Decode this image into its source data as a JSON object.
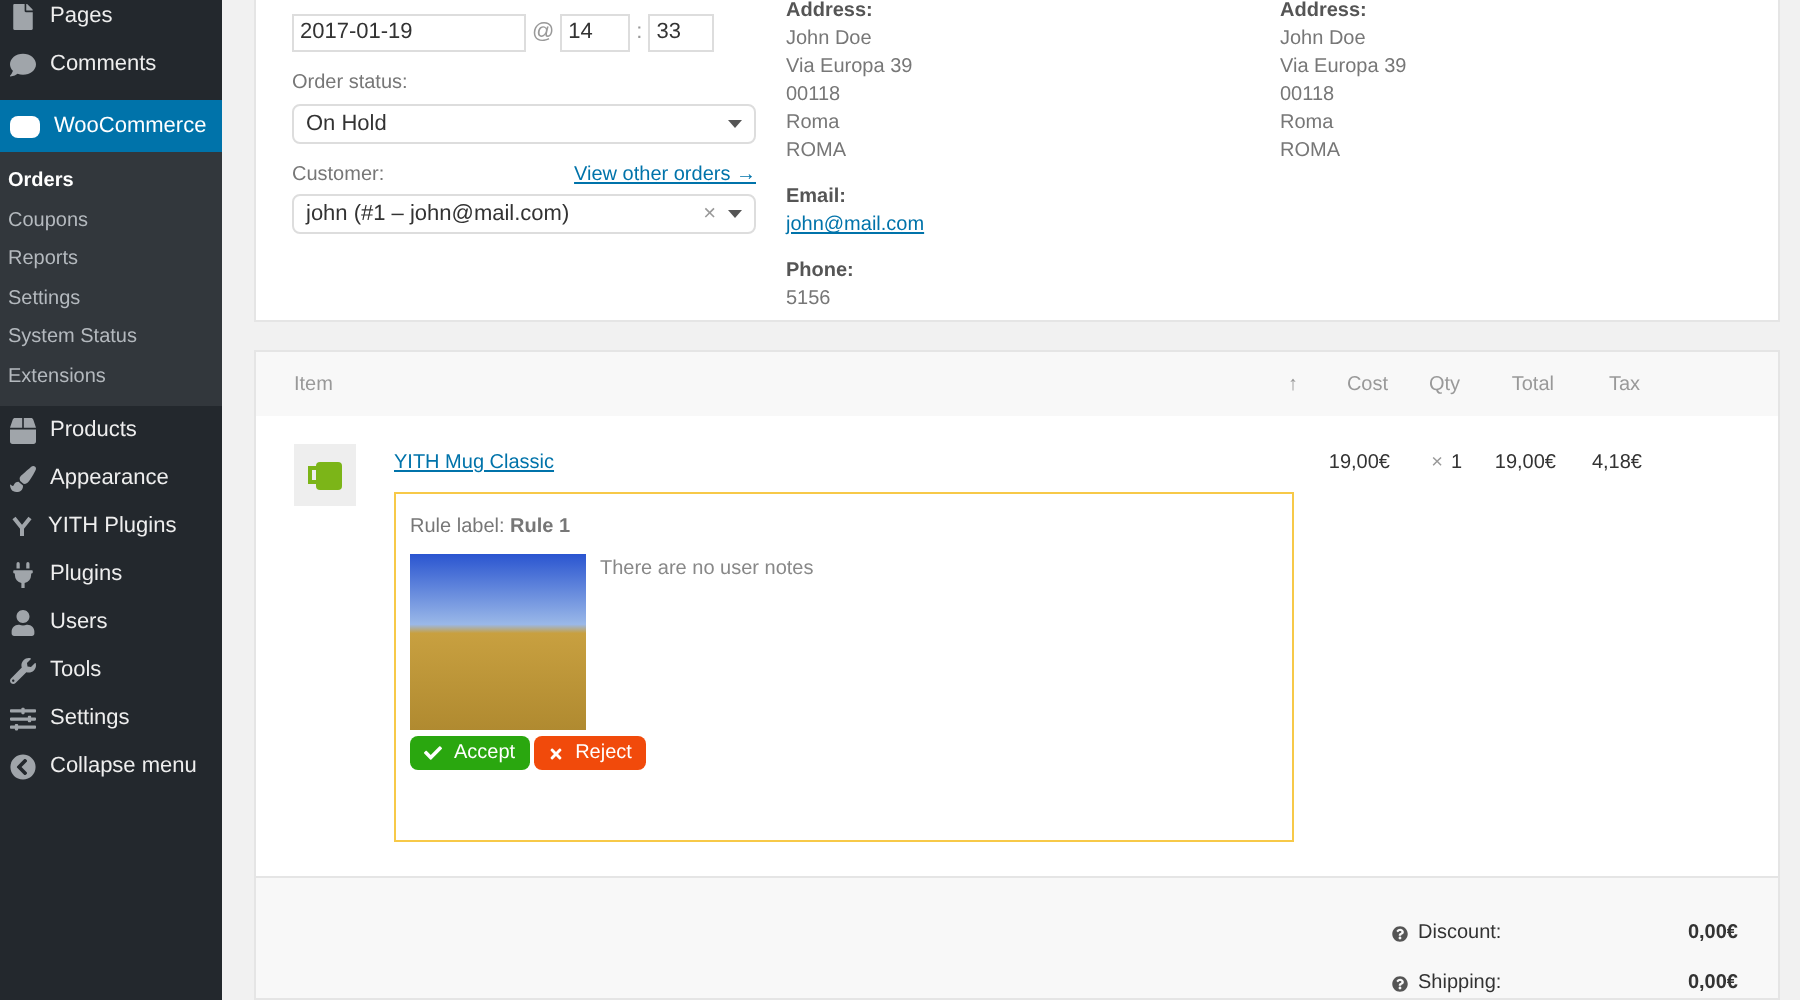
{
  "sidebar": {
    "items": [
      {
        "label": "Pages",
        "kind": "pages",
        "selected": false
      },
      {
        "label": "Comments",
        "kind": "comments",
        "selected": false
      },
      {
        "label": "WooCommerce",
        "kind": "woo",
        "selected": true,
        "children": [
          {
            "label": "Orders",
            "selected": true
          },
          {
            "label": "Coupons",
            "selected": false
          },
          {
            "label": "Reports",
            "selected": false
          },
          {
            "label": "Settings",
            "selected": false
          },
          {
            "label": "System Status",
            "selected": false
          },
          {
            "label": "Extensions",
            "selected": false
          }
        ]
      },
      {
        "label": "Products",
        "kind": "products",
        "selected": false
      },
      {
        "label": "Appearance",
        "kind": "appearance",
        "selected": false
      },
      {
        "label": "YITH Plugins",
        "kind": "yith",
        "selected": false
      },
      {
        "label": "Plugins",
        "kind": "plugins",
        "selected": false
      },
      {
        "label": "Users",
        "kind": "users",
        "selected": false
      },
      {
        "label": "Tools",
        "kind": "tools",
        "selected": false
      },
      {
        "label": "Settings",
        "kind": "settings",
        "selected": false
      },
      {
        "label": "Collapse menu",
        "kind": "collapse",
        "selected": false
      }
    ]
  },
  "order": {
    "date": "2017-01-19",
    "at": "@",
    "hour": "14",
    "sep": ":",
    "minute": "33",
    "status_label": "Order status:",
    "status": "On Hold",
    "customer_label": "Customer:",
    "other_orders_link": "View other orders →",
    "customer": "john (#1 – john@mail.com)",
    "clear": "×"
  },
  "billing": {
    "address_label": "Address:",
    "address": [
      "John Doe",
      "Via Europa 39",
      "00118",
      "Roma",
      "ROMA"
    ],
    "email_label": "Email:",
    "email": "john@mail.com",
    "phone_label": "Phone:",
    "phone": "5156"
  },
  "shipping": {
    "address_label": "Address:",
    "address": [
      "John Doe",
      "Via Europa 39",
      "00118",
      "Roma",
      "ROMA"
    ]
  },
  "items_table": {
    "columns": [
      "Item",
      "↑",
      "Cost",
      "Qty",
      "Total",
      "Tax"
    ],
    "rows": [
      {
        "name": "YITH Mug Classic",
        "cost": "19,00€",
        "qty_prefix": "×",
        "qty": "1",
        "total": "19,00€",
        "tax": "4,18€",
        "rule": {
          "label": "Rule label: **Rule 1**",
          "notes": "There are no user notes",
          "accept": "Accept",
          "reject": "Reject"
        }
      }
    ]
  },
  "totals": [
    {
      "label": "Discount:",
      "value": "0,00€"
    },
    {
      "label": "Shipping:",
      "value": "0,00€"
    }
  ]
}
